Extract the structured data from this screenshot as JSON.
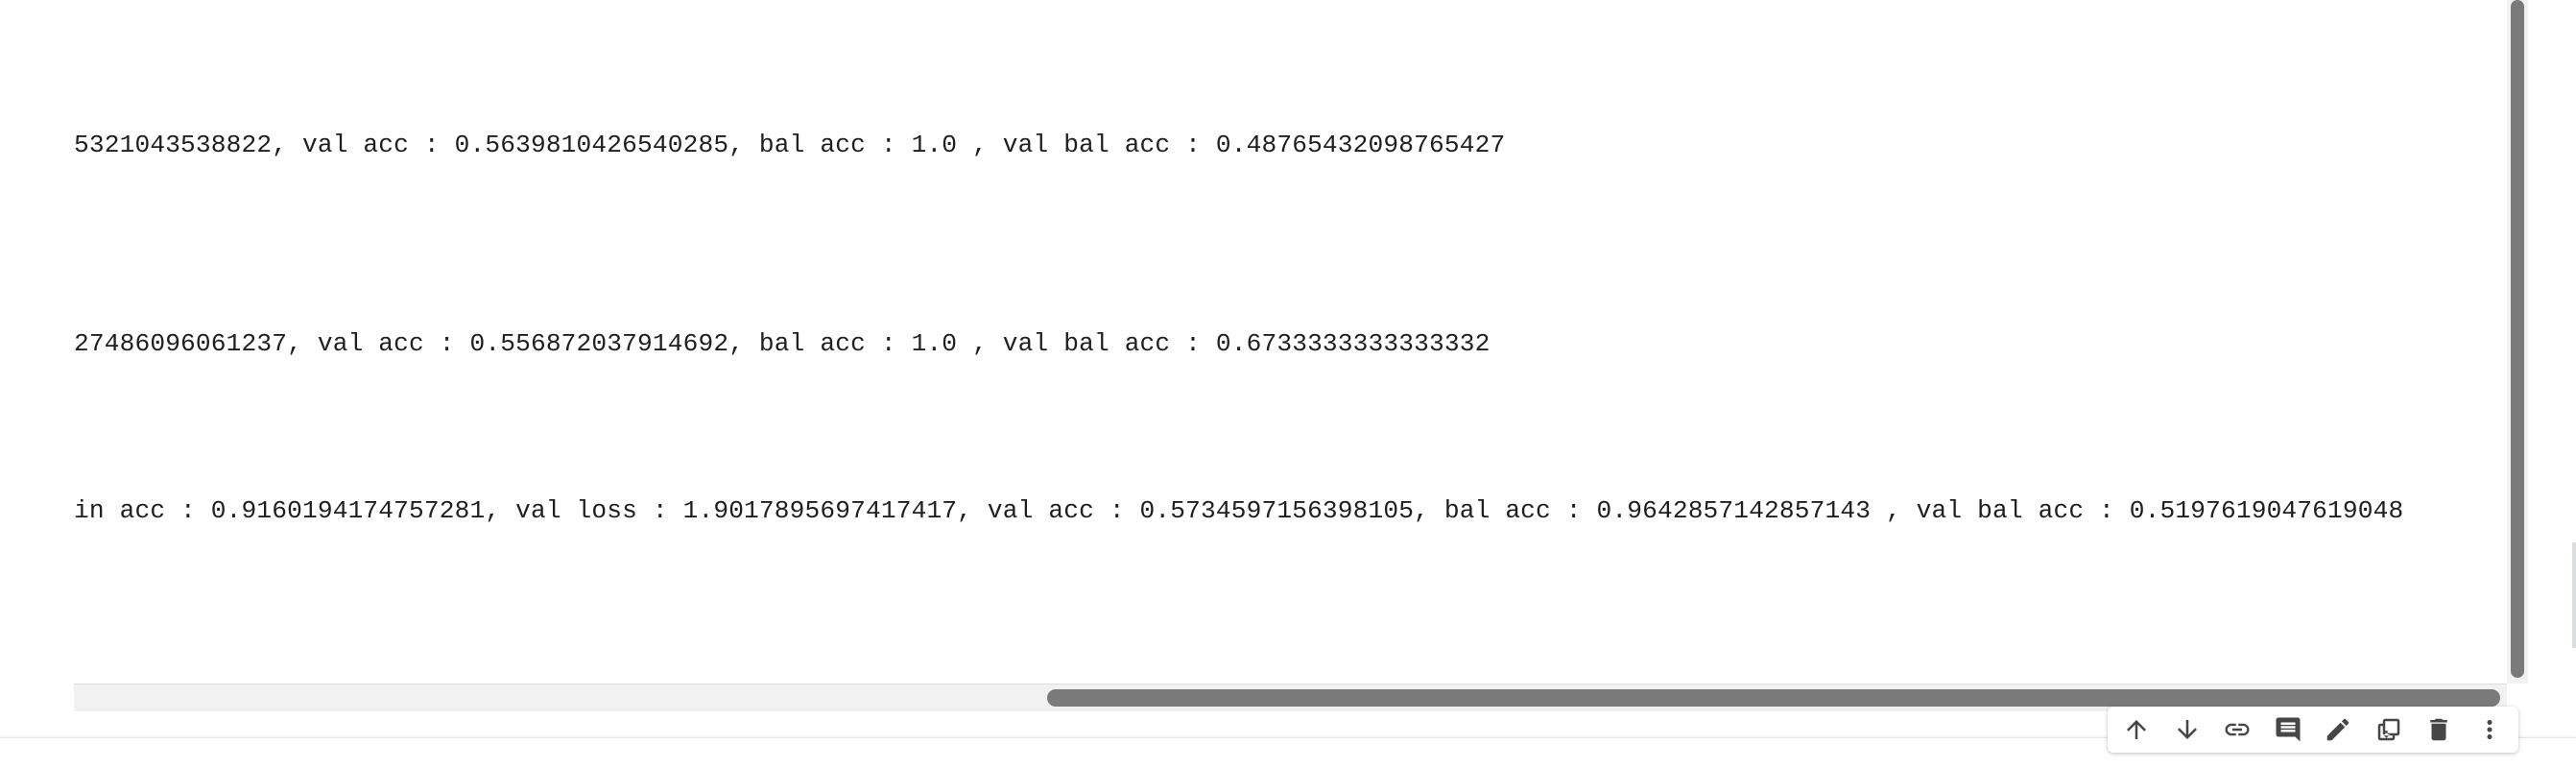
{
  "output": {
    "lines": [
      "5321043538822, val acc : 0.5639810426540285, bal acc : 1.0 , val bal acc : 0.48765432098765427",
      "27486096061237, val acc : 0.556872037914692, bal acc : 1.0 , val bal acc : 0.6733333333333332",
      "in acc : 0.9160194174757281, val loss : 1.9017895697417417, val acc : 0.5734597156398105, bal acc : 0.9642857142857143 , val bal acc : 0.5197619047619048"
    ]
  },
  "toolbar": {
    "buttons": [
      {
        "icon": "arrow-up-icon"
      },
      {
        "icon": "arrow-down-icon"
      },
      {
        "icon": "link-icon"
      },
      {
        "icon": "comment-icon"
      },
      {
        "icon": "pencil-icon"
      },
      {
        "icon": "mirror-cell-icon"
      },
      {
        "icon": "trash-icon"
      },
      {
        "icon": "more-vert-icon"
      }
    ]
  },
  "colors": {
    "text": "#1f1f1f",
    "scrollbar_thumb": "#7a7a7a",
    "scrollbar_track": "#f1f1f1",
    "toolbar_icon": "#444746"
  }
}
